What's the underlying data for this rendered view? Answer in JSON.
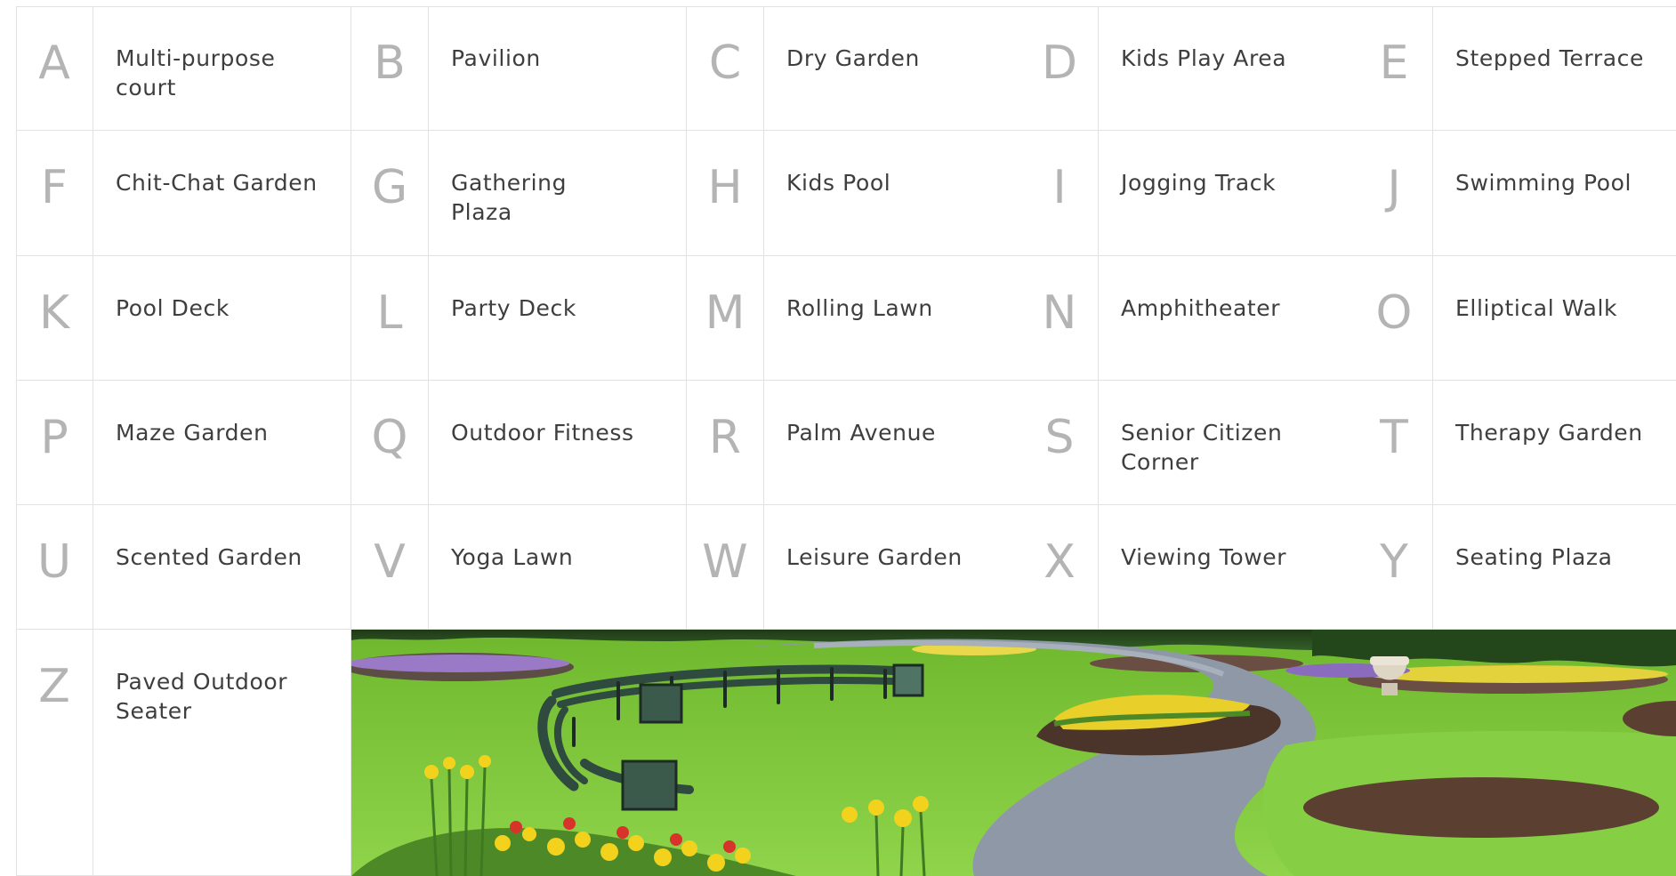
{
  "legend": [
    [
      {
        "letter": "A",
        "name": "Multi-purpose\ncourt"
      },
      {
        "letter": "B",
        "name": "Pavilion"
      },
      {
        "letter": "C",
        "name": "Dry Garden"
      },
      {
        "letter": "D",
        "name": "Kids Play Area"
      },
      {
        "letter": "E",
        "name": "Stepped Terrace"
      }
    ],
    [
      {
        "letter": "F",
        "name": "Chit-Chat Garden"
      },
      {
        "letter": "G",
        "name": "Gathering\nPlaza"
      },
      {
        "letter": "H",
        "name": "Kids Pool"
      },
      {
        "letter": "I",
        "name": "Jogging Track"
      },
      {
        "letter": "J",
        "name": "Swimming Pool"
      }
    ],
    [
      {
        "letter": "K",
        "name": "Pool Deck"
      },
      {
        "letter": "L",
        "name": "Party Deck"
      },
      {
        "letter": "M",
        "name": "Rolling Lawn"
      },
      {
        "letter": "N",
        "name": "Amphitheater"
      },
      {
        "letter": "O",
        "name": "Elliptical Walk"
      }
    ],
    [
      {
        "letter": "P",
        "name": "Maze Garden"
      },
      {
        "letter": "Q",
        "name": "Outdoor Fitness"
      },
      {
        "letter": "R",
        "name": "Palm Avenue"
      },
      {
        "letter": "S",
        "name": "Senior Citizen\nCorner"
      },
      {
        "letter": "T",
        "name": "Therapy Garden"
      }
    ],
    [
      {
        "letter": "U",
        "name": "Scented Garden"
      },
      {
        "letter": "V",
        "name": "Yoga Lawn"
      },
      {
        "letter": "W",
        "name": "Leisure Garden"
      },
      {
        "letter": "X",
        "name": "Viewing Tower"
      },
      {
        "letter": "Y",
        "name": "Seating Plaza"
      }
    ],
    [
      {
        "letter": "Z",
        "name": "Paved Outdoor\nSeater"
      }
    ]
  ],
  "colors": {
    "grid_line": "#e2e2e2",
    "letter": "#b4b4b4",
    "label": "#3e3e3e",
    "lawn": "#7cc63a",
    "path": "#8e98a6",
    "daffodil": "#f2d21c"
  },
  "photo": {
    "subject": "park-garden-photo"
  }
}
